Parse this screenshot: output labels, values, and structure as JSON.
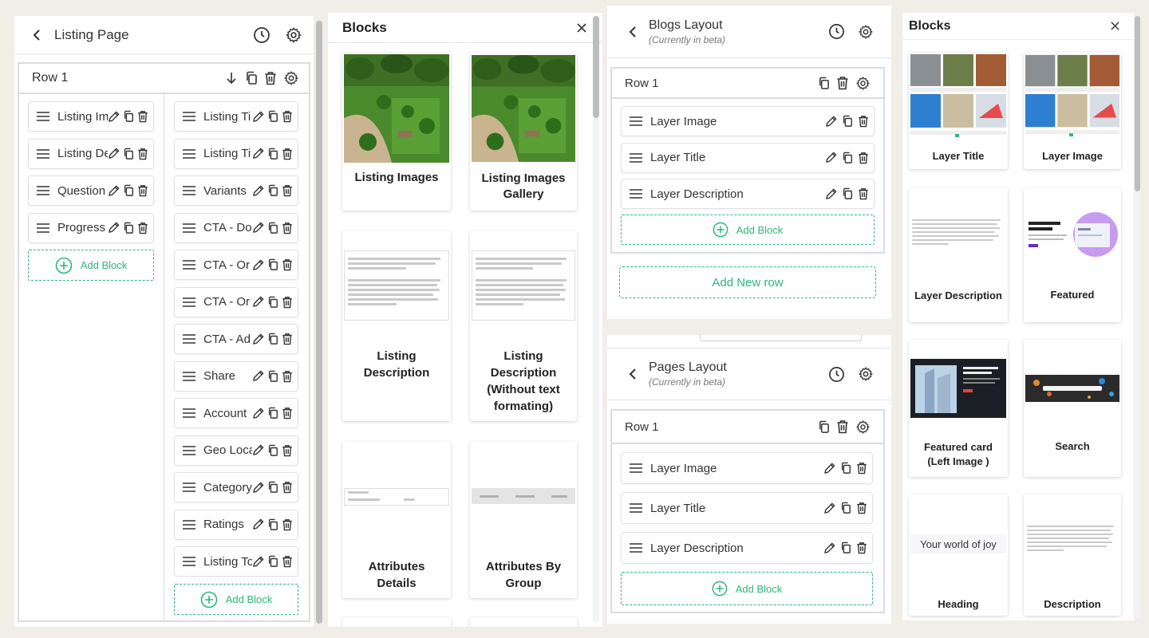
{
  "colors": {
    "accent_green": "#2db57a",
    "background": "#f1ede7",
    "panel": "#ffffff",
    "border": "#dcdcdc"
  },
  "listing_page": {
    "title": "Listing Page",
    "row_label": "Row 1",
    "left_column": [
      "Listing Im",
      "Listing De",
      "Question",
      "Progress"
    ],
    "right_column": [
      "Listing Ti",
      "Listing Ti",
      "Variants",
      "CTA - Do",
      "CTA - Or",
      "CTA - Or",
      "CTA - Ad",
      "Share",
      "Account",
      "Geo Loca",
      "Category",
      "Ratings",
      "Listing To"
    ],
    "add_block_label": "Add Block"
  },
  "blocks_panel_1": {
    "title": "Blocks",
    "cards": [
      "Listing Images",
      "Listing Images Gallery",
      "Listing Description",
      "Listing Description (Without text formating)",
      "Attributes Details",
      "Attributes By Group"
    ]
  },
  "blogs_layout": {
    "title": "Blogs Layout",
    "subtitle": "(Currently in beta)",
    "row_label": "Row 1",
    "items": [
      "Layer Image",
      "Layer Title",
      "Layer Description"
    ],
    "add_block_label": "Add Block",
    "add_row_label": "Add New row"
  },
  "pages_layout": {
    "title": "Pages Layout",
    "subtitle": "(Currently in beta)",
    "row_label": "Row 1",
    "items": [
      "Layer Image",
      "Layer Title",
      "Layer Description"
    ],
    "add_block_label": "Add Block"
  },
  "blocks_panel_2": {
    "title": "Blocks",
    "cards": [
      "Layer Title",
      "Layer Image",
      "Layer Description",
      "Featured",
      "Featured card (Left Image )",
      "Search",
      "Heading",
      "Description"
    ],
    "heading_preview": "Your world of joy"
  }
}
